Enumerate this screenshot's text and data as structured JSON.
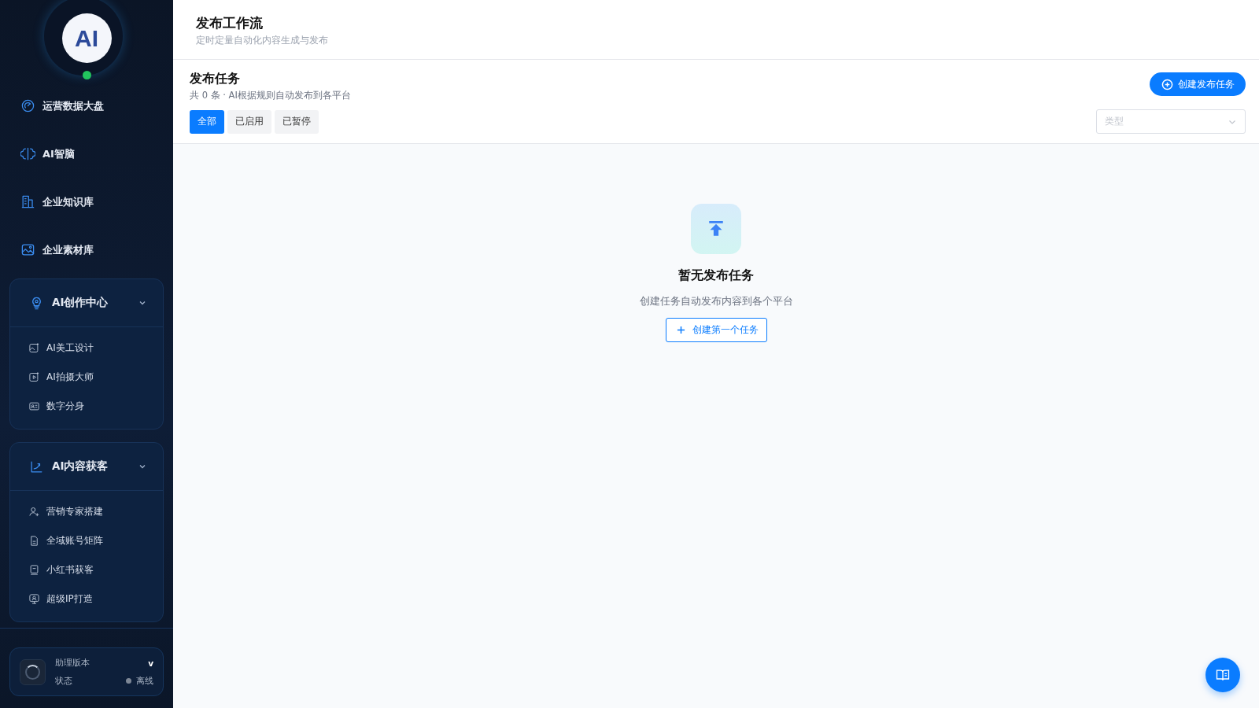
{
  "sidebar": {
    "logo": "AI",
    "items": [
      {
        "label": "运营数据大盘"
      },
      {
        "label": "AI智脑"
      },
      {
        "label": "企业知识库"
      },
      {
        "label": "企业素材库"
      }
    ],
    "groups": [
      {
        "label": "AI创作中心",
        "expanded": true,
        "children": [
          {
            "label": "AI美工设计"
          },
          {
            "label": "AI拍摄大师"
          },
          {
            "label": "数字分身"
          }
        ]
      },
      {
        "label": "AI内容获客",
        "expanded": true,
        "children": [
          {
            "label": "营销专家搭建"
          },
          {
            "label": "全域账号矩阵"
          },
          {
            "label": "小红书获客"
          },
          {
            "label": "超级IP打造"
          }
        ]
      }
    ],
    "assistant": {
      "title": "助理版本",
      "version": "v",
      "status_label": "状态",
      "status": "离线",
      "online": false
    }
  },
  "header": {
    "title": "发布工作流",
    "subtitle": "定时定量自动化内容生成与发布"
  },
  "section": {
    "title": "发布任务",
    "summary": "共 0 条 · AI根据规则自动发布到各平台",
    "create_button": "创建发布任务",
    "tabs": [
      {
        "label": "全部",
        "selected": true
      },
      {
        "label": "已启用",
        "selected": false
      },
      {
        "label": "已暂停",
        "selected": false
      }
    ],
    "type_select": {
      "placeholder": "类型"
    }
  },
  "empty_state": {
    "title": "暂无发布任务",
    "text": "创建任务自动发布内容到各个平台",
    "button": "创建第一个任务"
  }
}
